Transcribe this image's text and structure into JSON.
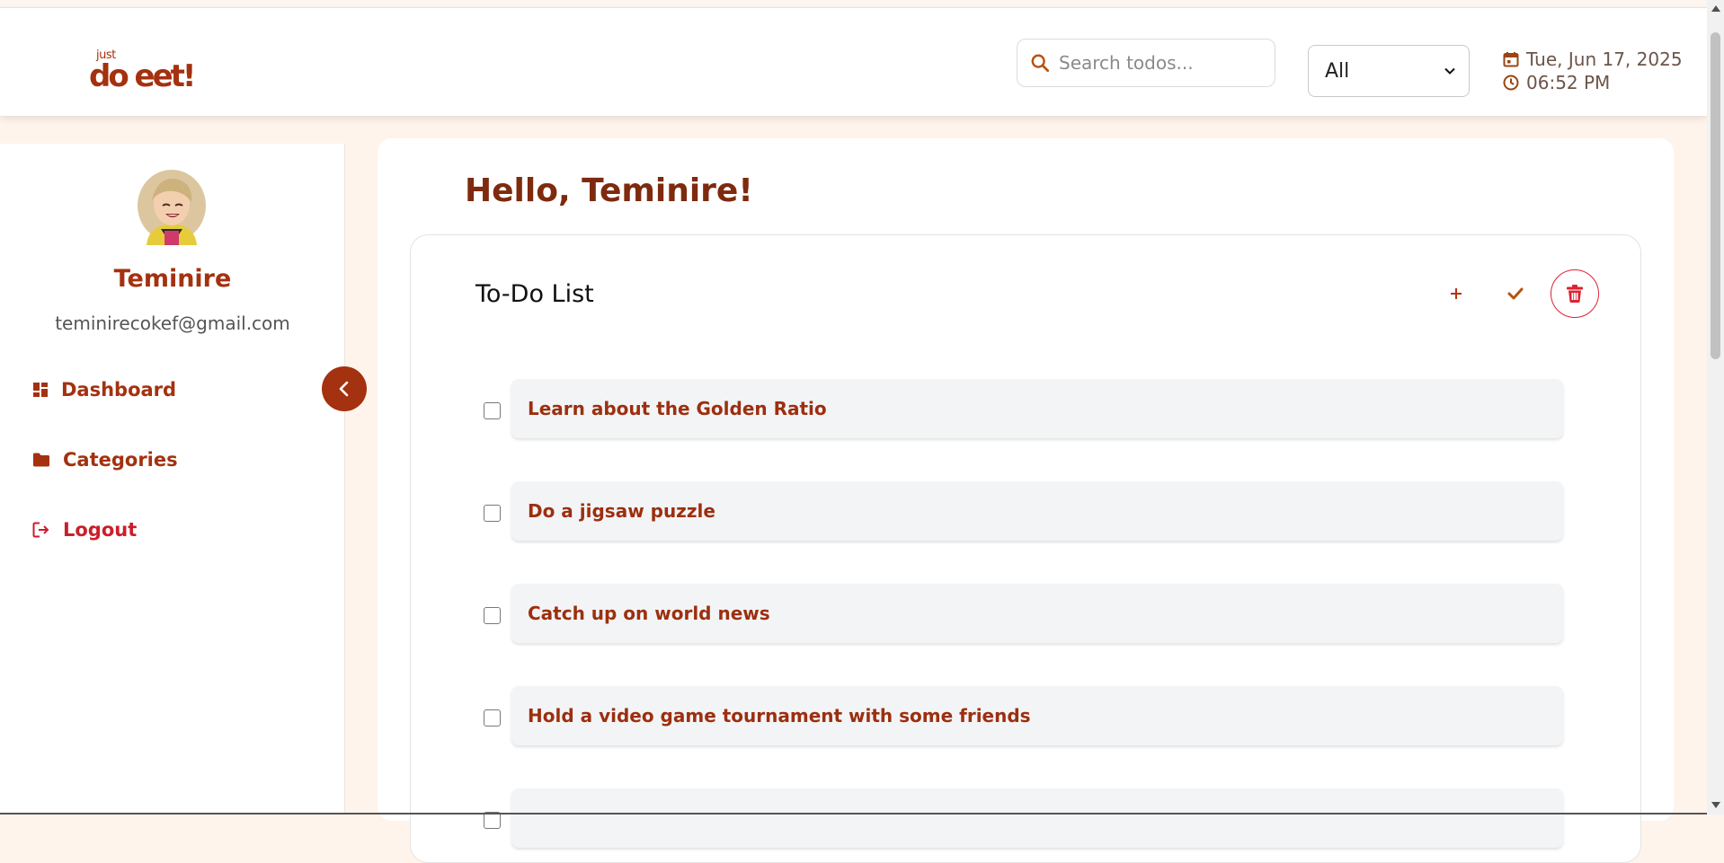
{
  "header": {
    "logo_small": "just",
    "logo_big": "do eet!",
    "search_placeholder": "Search todos...",
    "filter_value": "All",
    "date": "Tue, Jun 17, 2025",
    "time": "06:52 PM"
  },
  "sidebar": {
    "user_name": "Teminire",
    "user_email": "teminirecokef@gmail.com",
    "nav": [
      {
        "label": "Dashboard",
        "icon": "dashboard-icon"
      },
      {
        "label": "Categories",
        "icon": "folder-icon"
      },
      {
        "label": "Logout",
        "icon": "logout-icon"
      }
    ]
  },
  "main": {
    "greeting": "Hello, Teminire!",
    "todo_title": "To-Do List",
    "todos": [
      "Learn about the Golden Ratio",
      "Do a jigsaw puzzle",
      "Catch up on world news",
      "Hold a video game tournament with some friends",
      ""
    ]
  },
  "colors": {
    "brand": "#a4310f",
    "danger": "#dd2231",
    "page_bg": "#fef4ec",
    "todo_bg": "#f3f4f6"
  }
}
